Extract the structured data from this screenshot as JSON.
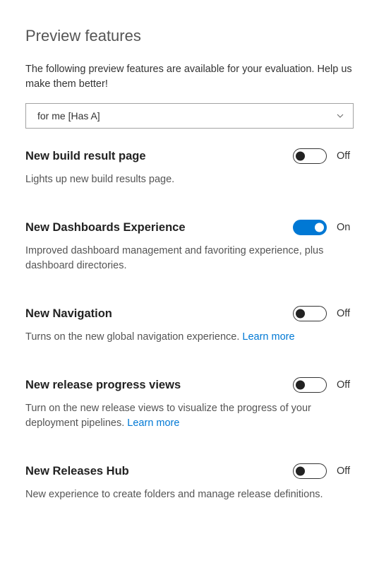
{
  "title": "Preview features",
  "intro": "The following preview features are available for your evaluation. Help us make them better!",
  "dropdown": {
    "selected": "for me [Has A]"
  },
  "toggleLabels": {
    "on": "On",
    "off": "Off"
  },
  "features": [
    {
      "title": "New build result page",
      "description": "Lights up new build results page.",
      "enabled": false,
      "link": null
    },
    {
      "title": "New Dashboards Experience",
      "description": "Improved dashboard management and favoriting experience, plus dashboard directories.",
      "enabled": true,
      "link": null
    },
    {
      "title": "New Navigation",
      "description": "Turns on the new global navigation experience. ",
      "enabled": false,
      "link": "Learn more"
    },
    {
      "title": "New release progress views",
      "description": "Turn on the new release views to visualize the progress of your deployment pipelines. ",
      "enabled": false,
      "link": "Learn more"
    },
    {
      "title": "New Releases Hub",
      "description": "New experience to create folders and manage release definitions.",
      "enabled": false,
      "link": null
    }
  ]
}
